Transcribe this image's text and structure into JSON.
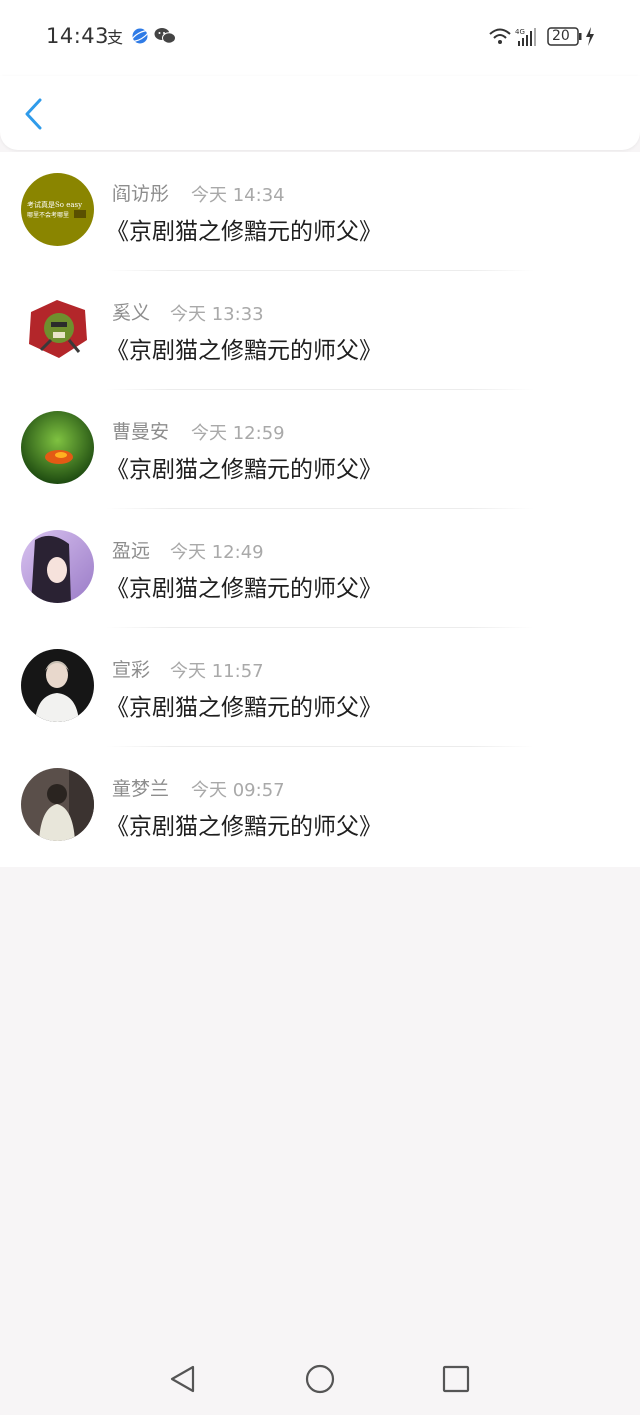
{
  "status_bar": {
    "time": "14:43",
    "app_icons": [
      "alipay-icon",
      "browser-icon",
      "wechat-icon"
    ],
    "battery": "20"
  },
  "header": {
    "back_icon": "chevron-left-icon",
    "accent": "#2f9bea"
  },
  "items": [
    {
      "name": "阎访彤",
      "time": "今天 14:34",
      "title": "《京剧猫之修黯元的师父》"
    },
    {
      "name": "奚义",
      "time": "今天 13:33",
      "title": "《京剧猫之修黯元的师父》"
    },
    {
      "name": "曹曼安",
      "time": "今天 12:59",
      "title": "《京剧猫之修黯元的师父》"
    },
    {
      "name": "盈远",
      "time": "今天 12:49",
      "title": "《京剧猫之修黯元的师父》"
    },
    {
      "name": "宣彩",
      "time": "今天 11:57",
      "title": "《京剧猫之修黯元的师父》"
    },
    {
      "name": "童梦兰",
      "time": "今天 09:57",
      "title": "《京剧猫之修黯元的师父》"
    }
  ],
  "avatar_text": {
    "line1": "考试真是So easy",
    "line2": "哪里不会考哪里"
  },
  "nav": {
    "icons": [
      "back-triangle-icon",
      "home-circle-icon",
      "recents-square-icon"
    ]
  }
}
